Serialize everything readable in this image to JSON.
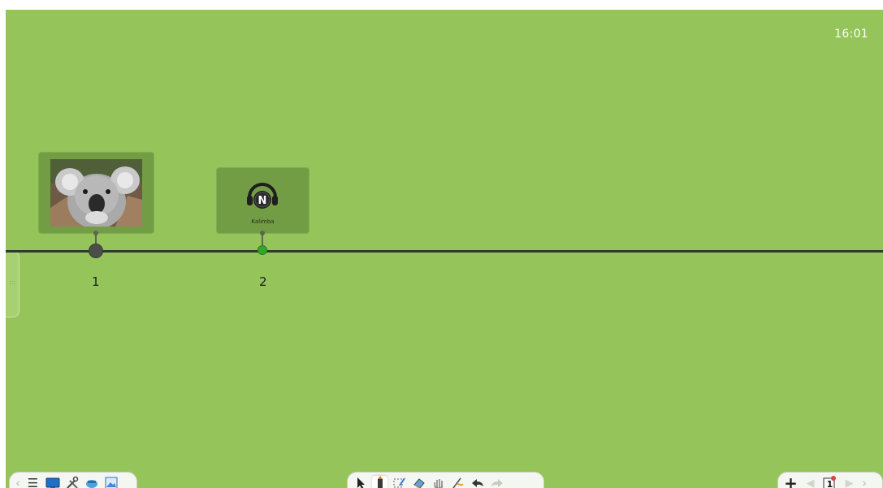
{
  "clock": "16:01",
  "timeline": {
    "items": [
      {
        "label": "1",
        "media": "koala-photo",
        "node_color": "#4a4f49"
      },
      {
        "label": "2",
        "media": "audio-file",
        "caption": "Kalimba",
        "node_color": "#35a62a"
      }
    ]
  },
  "colors": {
    "canvas": "#95c45a",
    "card": "#739d45",
    "timeline_line": "#2f3a2a",
    "toolbar": "#f4f6f2"
  },
  "toolbars": {
    "left": {
      "icons": [
        "collapse-left-icon",
        "menu-icon",
        "display-icon",
        "tools-icon",
        "cloud-icon",
        "image-library-icon"
      ]
    },
    "center": {
      "icons": [
        "select-arrow-icon",
        "pen-icon",
        "lasso-icon",
        "eraser-icon",
        "roam-hand-icon",
        "smart-pen-icon",
        "undo-icon",
        "redo-icon"
      ],
      "active": "pen-icon"
    },
    "right": {
      "icons": [
        "add-page-icon",
        "previous-page-icon",
        "page-thumbnail-icon",
        "next-page-icon",
        "collapse-right-icon"
      ],
      "page_number": "1"
    }
  }
}
